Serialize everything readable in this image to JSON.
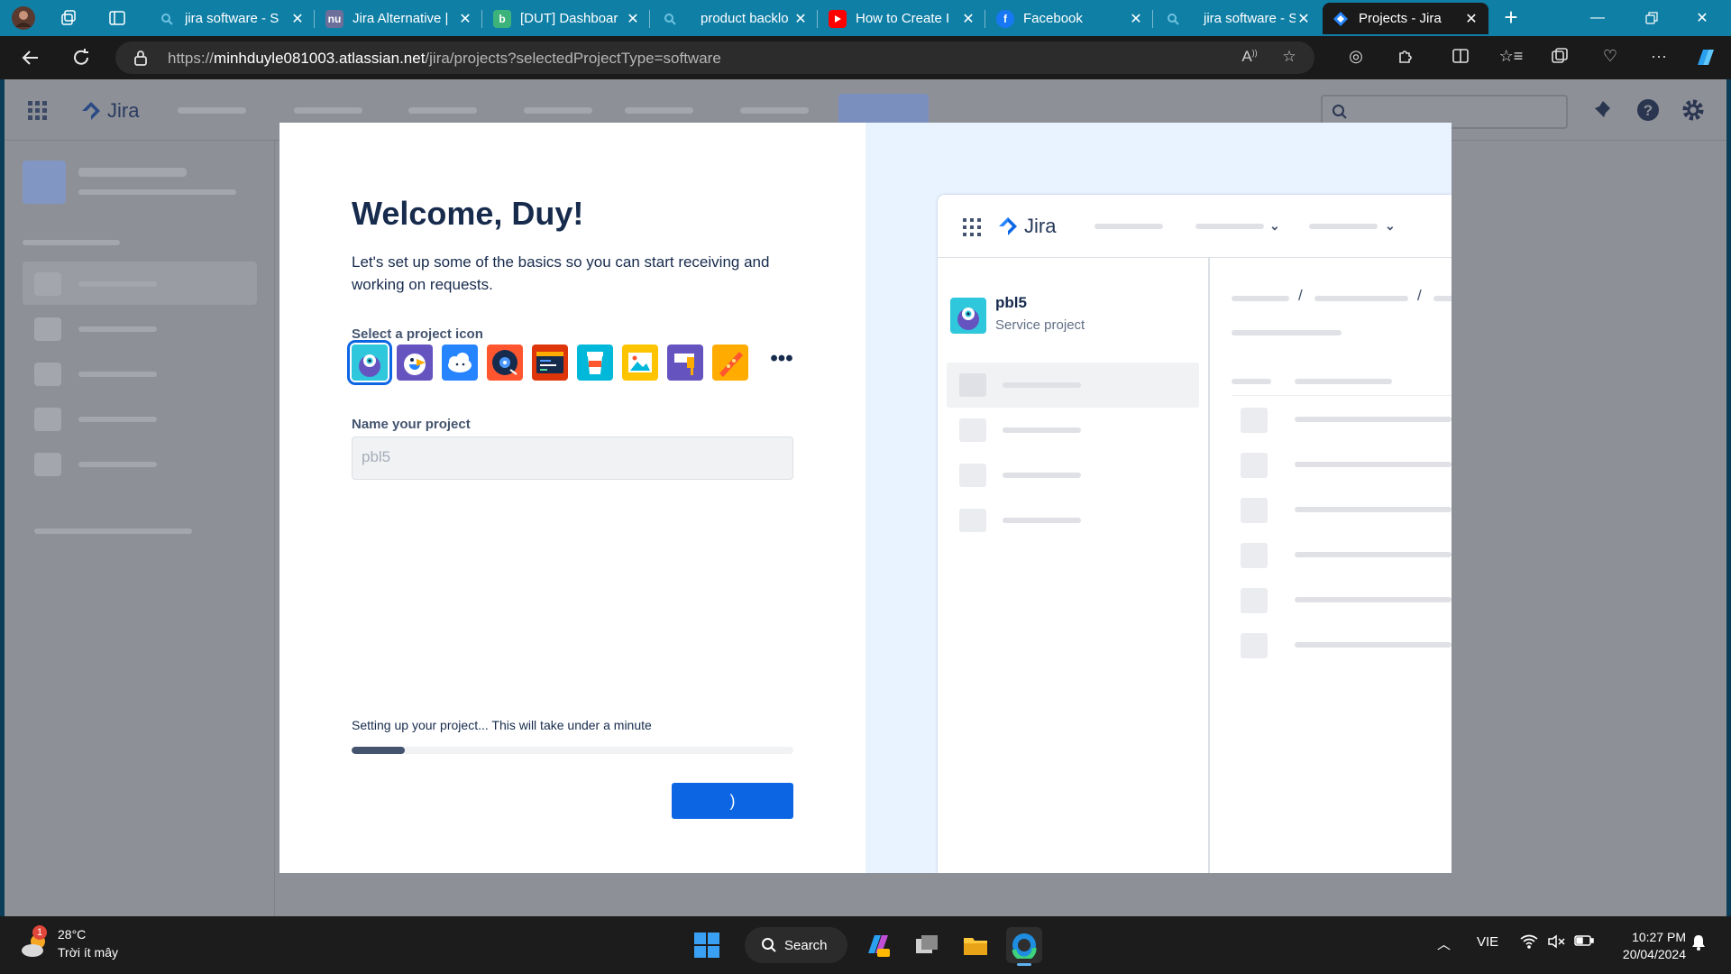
{
  "browser": {
    "tabs": [
      {
        "label": "jira software - S",
        "favicon": "search-icon",
        "color": "#0f7fa6"
      },
      {
        "label": "Jira Alternative |",
        "favicon": "nu-logo",
        "color": "#6b6f9a"
      },
      {
        "label": "[DUT] Dashboar",
        "favicon": "b-logo",
        "color": "#3bb37a"
      },
      {
        "label": "product backlo",
        "favicon": "search-icon",
        "color": "#0f7fa6"
      },
      {
        "label": "How to Create I",
        "favicon": "youtube-icon",
        "color": "#ff0000"
      },
      {
        "label": "Facebook",
        "favicon": "facebook-icon",
        "color": "#1877f2"
      },
      {
        "label": "jira software - S",
        "favicon": "search-icon",
        "color": "#0f7fa6"
      },
      {
        "label": "Projects - Jira",
        "favicon": "jira-icon",
        "color": "#2684ff"
      }
    ],
    "new_tab": "+",
    "url_prefix": "https://",
    "url_host": "minhduyle081003.atlassian.net",
    "url_path": "/jira/projects?selectedProjectType=software",
    "tabbar_color": "#0f7fa6"
  },
  "jira": {
    "logo_text": "Jira"
  },
  "modal": {
    "welcome": "Welcome, Duy!",
    "subtitle": "Let's set up some of the basics so you can start receiving and working on requests.",
    "icon_label": "Select a project icon",
    "icons": [
      {
        "name": "monster-avatar",
        "bg": "#2fc7dc"
      },
      {
        "name": "bird-avatar",
        "bg": "#6554c0"
      },
      {
        "name": "cloud-avatar",
        "bg": "#2684ff"
      },
      {
        "name": "vinyl-avatar",
        "bg": "#ff5630"
      },
      {
        "name": "code-avatar",
        "bg": "#de350b"
      },
      {
        "name": "cup-avatar",
        "bg": "#00b8d9"
      },
      {
        "name": "image-avatar",
        "bg": "#ffc400"
      },
      {
        "name": "flag-avatar",
        "bg": "#6554c0"
      },
      {
        "name": "food-avatar",
        "bg": "#ffab00"
      }
    ],
    "more_label": "•••",
    "name_label": "Name your project",
    "name_value": "pbl5",
    "setup_text": "Setting up your project... This will take under a minute",
    "progress": 0.12,
    "button_spinner": ")",
    "accent": "#0c66e4"
  },
  "preview": {
    "logo_text": "Jira",
    "project_name": "pbl5",
    "project_type": "Service project",
    "breadcrumb_sep": "/"
  },
  "taskbar": {
    "temperature": "28°C",
    "weather": "Trời ít mây",
    "weather_badge": "1",
    "search_label": "Search",
    "language": "VIE",
    "time": "10:27 PM",
    "date": "20/04/2024"
  }
}
